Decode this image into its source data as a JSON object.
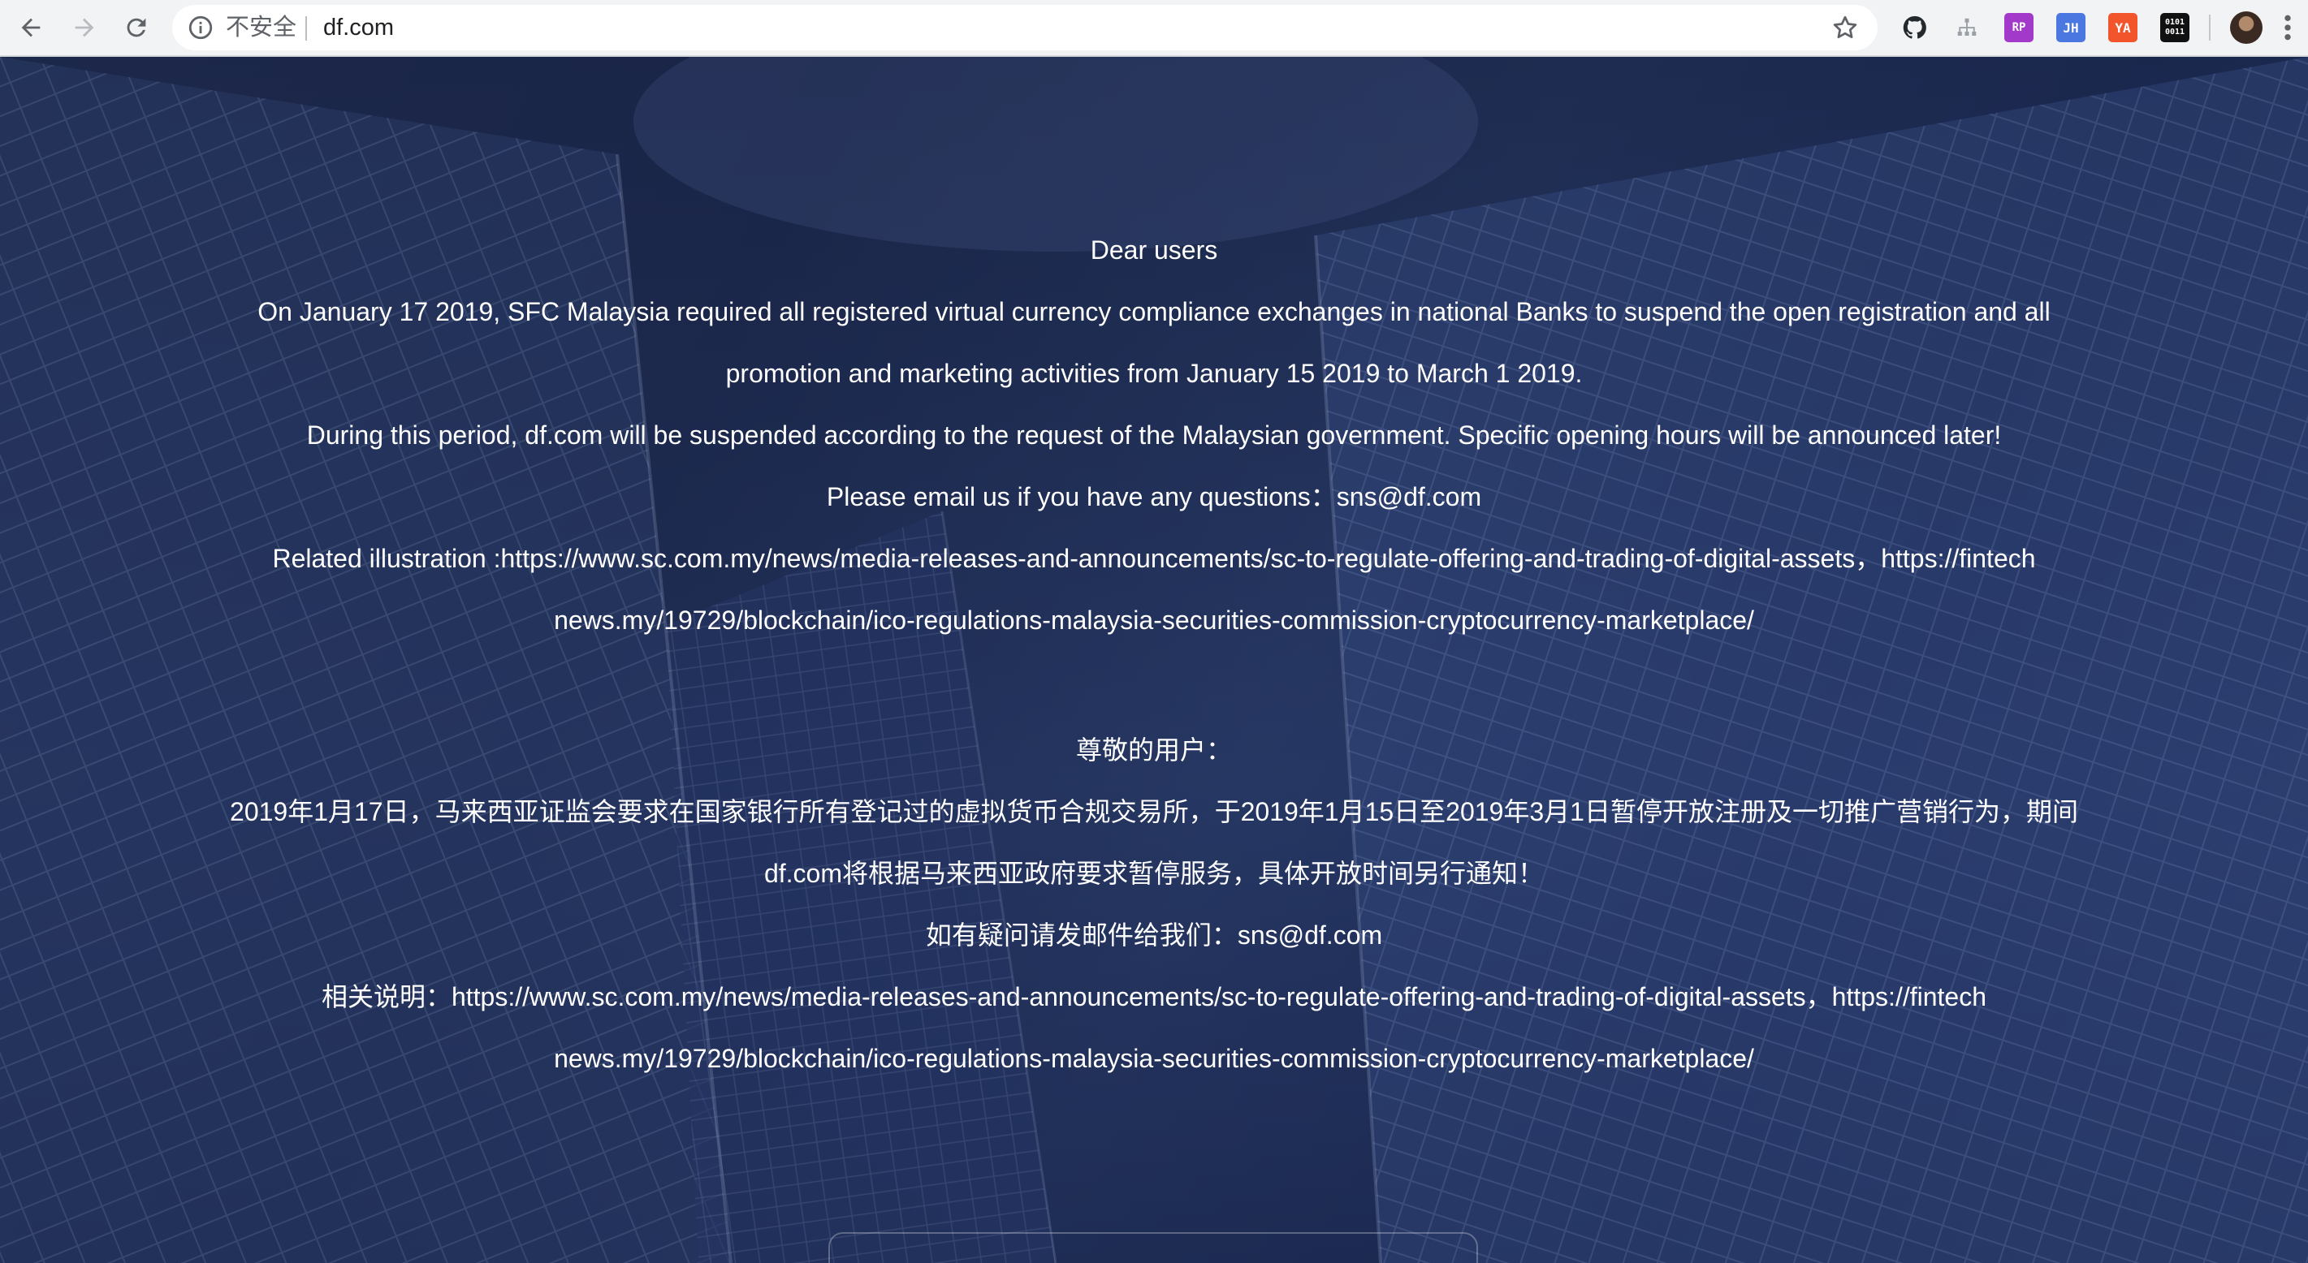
{
  "browser": {
    "security_label": "不安全",
    "url": "df.com"
  },
  "extensions": [
    {
      "name": "github-extension-icon",
      "text": "",
      "color": "#24292e"
    },
    {
      "name": "sitemap-extension-icon",
      "text": "",
      "color": "#9aa0a6"
    },
    {
      "name": "rp-extension-icon",
      "text": "RP",
      "color": "#a239ca"
    },
    {
      "name": "jh-extension-icon",
      "text": "JH",
      "color": "#4a78e0"
    },
    {
      "name": "yapi-extension-icon",
      "text": "YA",
      "color": "#f2552c"
    },
    {
      "name": "binary-extension-icon",
      "text": "0101\n0011",
      "color": "#111111"
    }
  ],
  "notice": {
    "en_greeting": "Dear users",
    "en_line1": "On January 17 2019, SFC Malaysia required all registered virtual currency compliance exchanges in national Banks to suspend the open registration and all",
    "en_line2": "promotion and marketing activities from January 15 2019 to March 1 2019.",
    "en_line3": "During this period, df.com will be suspended according to the request of the Malaysian government. Specific opening hours will be announced later!",
    "en_line4": "Please email us if you have any questions：sns@df.com",
    "en_line5": "Related illustration :https://www.sc.com.my/news/media-releases-and-announcements/sc-to-regulate-offering-and-trading-of-digital-assets，https://fintech",
    "en_line6": "news.my/19729/blockchain/ico-regulations-malaysia-securities-commission-cryptocurrency-marketplace/",
    "zh_greeting": "尊敬的用户：",
    "zh_line1": "2019年1月17日，马来西亚证监会要求在国家银行所有登记过的虚拟货币合规交易所，于2019年1月15日至2019年3月1日暂停开放注册及一切推广营销行为，期间",
    "zh_line2": "df.com将根据马来西亚政府要求暂停服务，具体开放时间另行通知！",
    "zh_line3": "如有疑问请发邮件给我们：sns@df.com",
    "zh_line4": "相关说明：https://www.sc.com.my/news/media-releases-and-announcements/sc-to-regulate-offering-and-trading-of-digital-assets，https://fintech",
    "zh_line5": "news.my/19729/blockchain/ico-regulations-malaysia-securities-commission-cryptocurrency-marketplace/"
  }
}
